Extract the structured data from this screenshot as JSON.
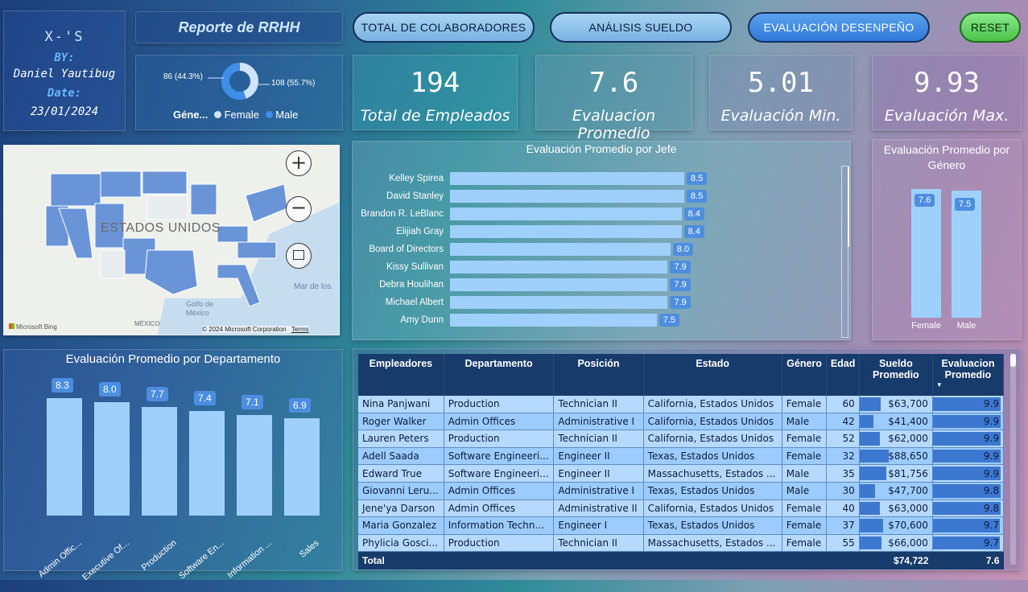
{
  "author_card": {
    "logo": "X-'S",
    "by_label": "BY:",
    "author": "Daniel Yautibug",
    "date_label": "Date:",
    "date": "23/01/2024"
  },
  "report_title": "Reporte de RRHH",
  "nav": {
    "total": "TOTAL DE COLABORADORES",
    "salary": "ANÁLISIS SUELDO",
    "evaluation": "EVALUACIÓN DESENPEÑO",
    "reset": "RESET"
  },
  "gender_donut": {
    "legend_title": "Géne...",
    "female_label": "Female",
    "male_label": "Male",
    "female_text": "86 (44.3%)",
    "male_text": "108 (55.7%)",
    "female_value": 86,
    "male_value": 108,
    "female_color": "#cfe3ff",
    "male_color": "#3f8ee8"
  },
  "kpis": [
    {
      "value": "194",
      "label": "Total de Empleados"
    },
    {
      "value": "7.6",
      "label": "Evaluacion Promedio"
    },
    {
      "value": "5.01",
      "label": "Evaluación Min."
    },
    {
      "value": "9.93",
      "label": "Evaluación Max."
    }
  ],
  "map": {
    "country_label": "ESTADOS UNIDOS",
    "sea_label": "Mar de los",
    "gulf_label": "Golfo de México",
    "mexico_label": "MÉXICO",
    "provider": "Microsoft Bing",
    "copyright": "© 2024 Microsoft Corporation",
    "terms": "Terms"
  },
  "chart_data": [
    {
      "type": "bar",
      "orientation": "horizontal",
      "title": "Evaluación Promedio por Jefe",
      "categories": [
        "Kelley Spirea",
        "David Stanley",
        "Brandon R. LeBlanc",
        "Elijiah Gray",
        "Board of Directors",
        "Kissy Sullivan",
        "Debra Houlihan",
        "Michael Albert",
        "Amy Dunn"
      ],
      "values": [
        8.5,
        8.5,
        8.4,
        8.4,
        8.0,
        7.9,
        7.9,
        7.9,
        7.5
      ],
      "labels": [
        "8.5",
        "8.5",
        "8.4",
        "8.4",
        "8.0",
        "7.9",
        "7.9",
        "7.9",
        "7.5"
      ],
      "color": "#9fd0fb"
    },
    {
      "type": "bar",
      "title": "Evaluación Promedio por Género",
      "categories": [
        "Female",
        "Male"
      ],
      "values": [
        7.6,
        7.5
      ],
      "labels": [
        "7.6",
        "7.5"
      ],
      "color": "#9fd0fb"
    },
    {
      "type": "bar",
      "title": "Evaluación Promedio por Departamento",
      "categories": [
        "Admin Offic...",
        "Executive Of...",
        "Production",
        "Software En...",
        "Information ...",
        "Sales"
      ],
      "values": [
        8.3,
        8.0,
        7.7,
        7.4,
        7.1,
        6.9
      ],
      "labels": [
        "8.3",
        "8.0",
        "7.7",
        "7.4",
        "7.1",
        "6.9"
      ],
      "color": "#9fd0fb"
    }
  ],
  "table": {
    "headers": [
      "Empleadores",
      "Departamento",
      "Posición",
      "Estado",
      "Género",
      "Edad",
      "Sueldo Promedio",
      "Evaluacion Promedio"
    ],
    "sort_indicator": "▼",
    "rows": [
      {
        "name": "Nina Panjwani",
        "dept": "Production",
        "pos": "Technician II",
        "state": "California, Estados Unidos",
        "gender": "Female",
        "age": "60",
        "salary": "$63,700",
        "salary_value": 63700,
        "eval": "9.9",
        "eval_value": 9.9
      },
      {
        "name": "Roger Walker",
        "dept": "Admin Offices",
        "pos": "Administrative I",
        "state": "California, Estados Unidos",
        "gender": "Male",
        "age": "42",
        "salary": "$41,400",
        "salary_value": 41400,
        "eval": "9.9",
        "eval_value": 9.9
      },
      {
        "name": "Lauren Peters",
        "dept": "Production",
        "pos": "Technician II",
        "state": "California, Estados Unidos",
        "gender": "Female",
        "age": "52",
        "salary": "$62,000",
        "salary_value": 62000,
        "eval": "9.9",
        "eval_value": 9.9
      },
      {
        "name": "Adell Saada",
        "dept": "Software Engineeri...",
        "pos": "Engineer II",
        "state": "Texas, Estados Unidos",
        "gender": "Female",
        "age": "32",
        "salary": "$88,650",
        "salary_value": 88650,
        "eval": "9.9",
        "eval_value": 9.9
      },
      {
        "name": "Edward True",
        "dept": "Software Engineeri...",
        "pos": "Engineer II",
        "state": "Massachusetts, Estados ...",
        "gender": "Male",
        "age": "35",
        "salary": "$81,756",
        "salary_value": 81756,
        "eval": "9.9",
        "eval_value": 9.9
      },
      {
        "name": "Giovanni Leru...",
        "dept": "Admin Offices",
        "pos": "Administrative I",
        "state": "Texas, Estados Unidos",
        "gender": "Male",
        "age": "30",
        "salary": "$47,700",
        "salary_value": 47700,
        "eval": "9.8",
        "eval_value": 9.8
      },
      {
        "name": "Jene'ya Darson",
        "dept": "Admin Offices",
        "pos": "Administrative II",
        "state": "California, Estados Unidos",
        "gender": "Female",
        "age": "40",
        "salary": "$63,000",
        "salary_value": 63000,
        "eval": "9.8",
        "eval_value": 9.8
      },
      {
        "name": "Maria Gonzalez",
        "dept": "Information Techn...",
        "pos": "Engineer I",
        "state": "Texas, Estados Unidos",
        "gender": "Female",
        "age": "37",
        "salary": "$70,600",
        "salary_value": 70600,
        "eval": "9.7",
        "eval_value": 9.7
      },
      {
        "name": "Phylicia Gosci...",
        "dept": "Production",
        "pos": "Technician II",
        "state": "Massachusetts, Estados ...",
        "gender": "Female",
        "age": "55",
        "salary": "$66,000",
        "salary_value": 66000,
        "eval": "9.7",
        "eval_value": 9.7
      }
    ],
    "total_label": "Total",
    "total_salary": "$74,722",
    "total_eval": "7.6"
  }
}
